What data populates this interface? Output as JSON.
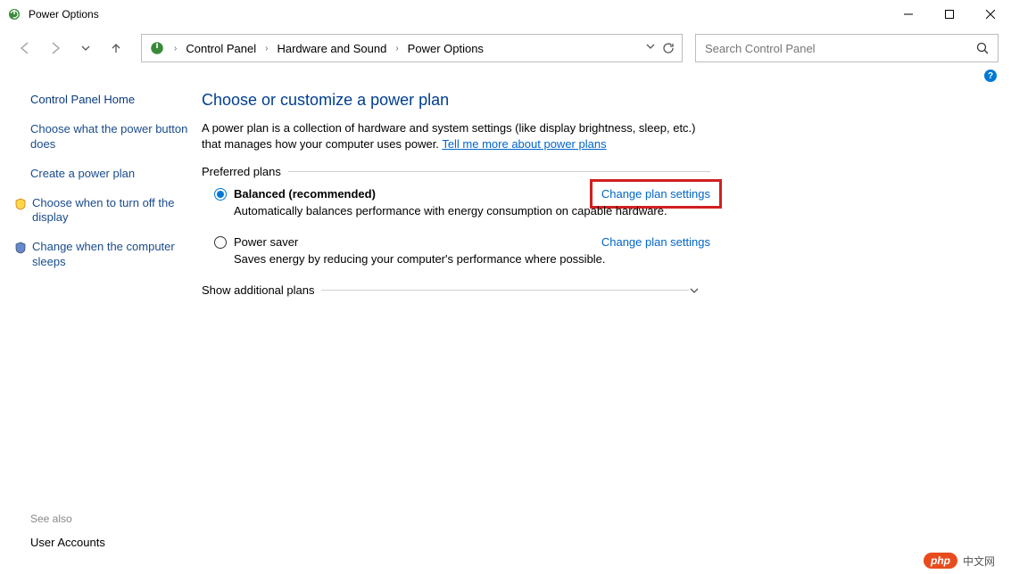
{
  "window": {
    "title": "Power Options"
  },
  "breadcrumb": {
    "items": [
      "Control Panel",
      "Hardware and Sound",
      "Power Options"
    ]
  },
  "search": {
    "placeholder": "Search Control Panel"
  },
  "sidebar": {
    "home": "Control Panel Home",
    "links": [
      "Choose what the power button does",
      "Create a power plan",
      "Choose when to turn off the display",
      "Change when the computer sleeps"
    ]
  },
  "main": {
    "title": "Choose or customize a power plan",
    "description_prefix": "A power plan is a collection of hardware and system settings (like display brightness, sleep, etc.) that manages how your computer uses power. ",
    "description_link": "Tell me more about power plans",
    "preferred_label": "Preferred plans",
    "plans": [
      {
        "name": "Balanced (recommended)",
        "desc": "Automatically balances performance with energy consumption on capable hardware.",
        "change_link": "Change plan settings",
        "selected": true,
        "highlighted": true
      },
      {
        "name": "Power saver",
        "desc": "Saves energy by reducing your computer's performance where possible.",
        "change_link": "Change plan settings",
        "selected": false,
        "highlighted": false
      }
    ],
    "show_additional": "Show additional plans"
  },
  "see_also": {
    "label": "See also",
    "link": "User Accounts"
  },
  "watermark": {
    "badge": "php",
    "text": "中文网"
  }
}
